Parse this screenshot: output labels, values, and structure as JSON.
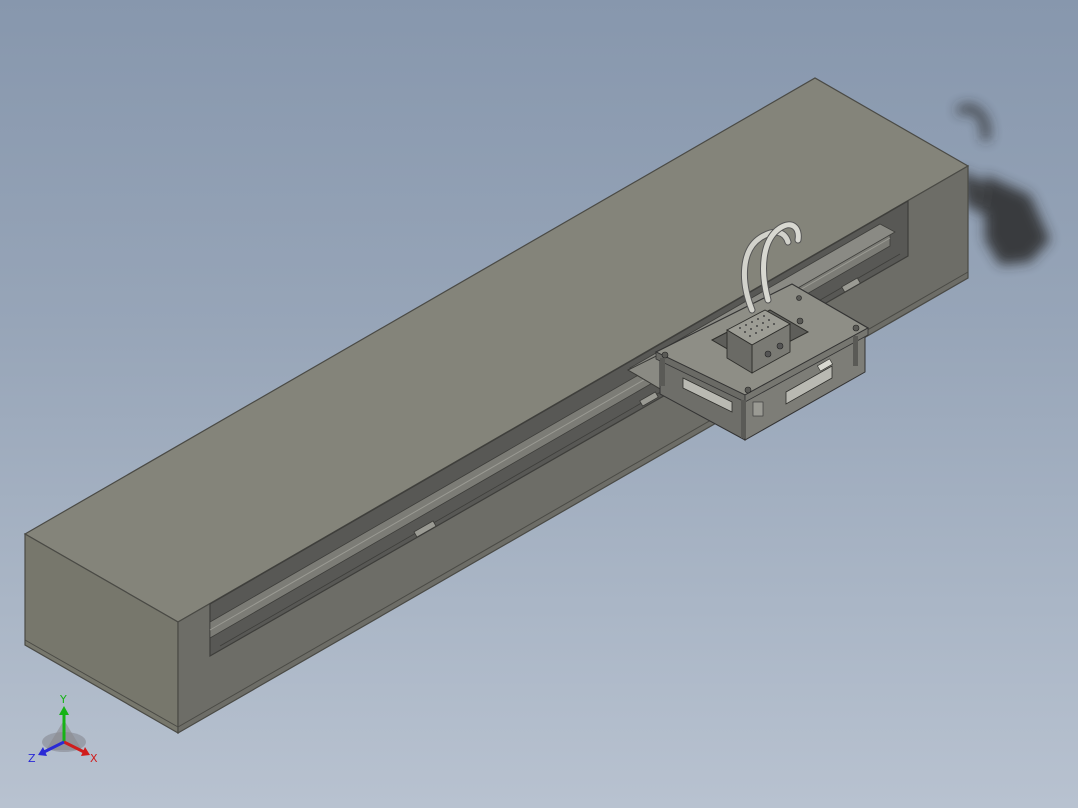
{
  "viewport": {
    "background_top": "#8797ad",
    "background_bottom": "#b8c2d0"
  },
  "model": {
    "housing_color": "#7b7b70",
    "housing_top": "#84847a",
    "housing_inner": "#5c5c58",
    "carriage_color": "#8e8e86",
    "cable_color": "#cfcfc8"
  },
  "triad": {
    "x_label": "X",
    "y_label": "Y",
    "z_label": "Z",
    "x_color": "#d01c1c",
    "y_color": "#16b316",
    "z_color": "#2a2ad6"
  }
}
